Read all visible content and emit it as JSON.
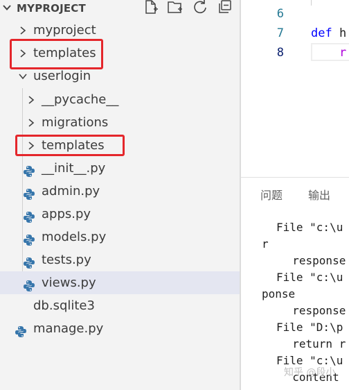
{
  "explorer": {
    "project_title": "MYPROJECT",
    "toolbar": {
      "new_file_icon": "new-file-icon",
      "new_folder_icon": "new-folder-icon",
      "refresh_icon": "refresh-icon",
      "collapse_icon": "collapse-all-icon"
    },
    "tree": [
      {
        "label": "myproject",
        "kind": "folder",
        "expanded": false
      },
      {
        "label": "templates",
        "kind": "folder",
        "expanded": false
      },
      {
        "label": "userlogin",
        "kind": "folder",
        "expanded": true
      },
      {
        "label": "__pycache__",
        "kind": "folder",
        "expanded": false
      },
      {
        "label": "migrations",
        "kind": "folder",
        "expanded": false
      },
      {
        "label": "templates",
        "kind": "folder",
        "expanded": false
      },
      {
        "label": "__init__.py",
        "kind": "python"
      },
      {
        "label": "admin.py",
        "kind": "python"
      },
      {
        "label": "apps.py",
        "kind": "python"
      },
      {
        "label": "models.py",
        "kind": "python"
      },
      {
        "label": "tests.py",
        "kind": "python"
      },
      {
        "label": "views.py",
        "kind": "python",
        "selected": true
      },
      {
        "label": "db.sqlite3",
        "kind": "file"
      },
      {
        "label": "manage.py",
        "kind": "python"
      }
    ]
  },
  "editor": {
    "line_numbers": [
      "6",
      "7",
      "8"
    ],
    "lines": [
      "",
      "def h",
      "    r"
    ]
  },
  "panel": {
    "tabs": [
      "问题",
      "输出"
    ],
    "terminal_lines": [
      "File \"c:\\u",
      "r",
      "  response",
      "File \"c:\\u",
      "ponse",
      "  response",
      "File \"D:\\p",
      "  return r",
      "File \"c:\\u",
      "  content "
    ],
    "watermark": "知乎 @段小"
  },
  "colors": {
    "highlight_border": "#e4262b",
    "python_icon_blue": "#3776ab",
    "keyword_blue": "#0000ff",
    "line_number": "#237893"
  }
}
